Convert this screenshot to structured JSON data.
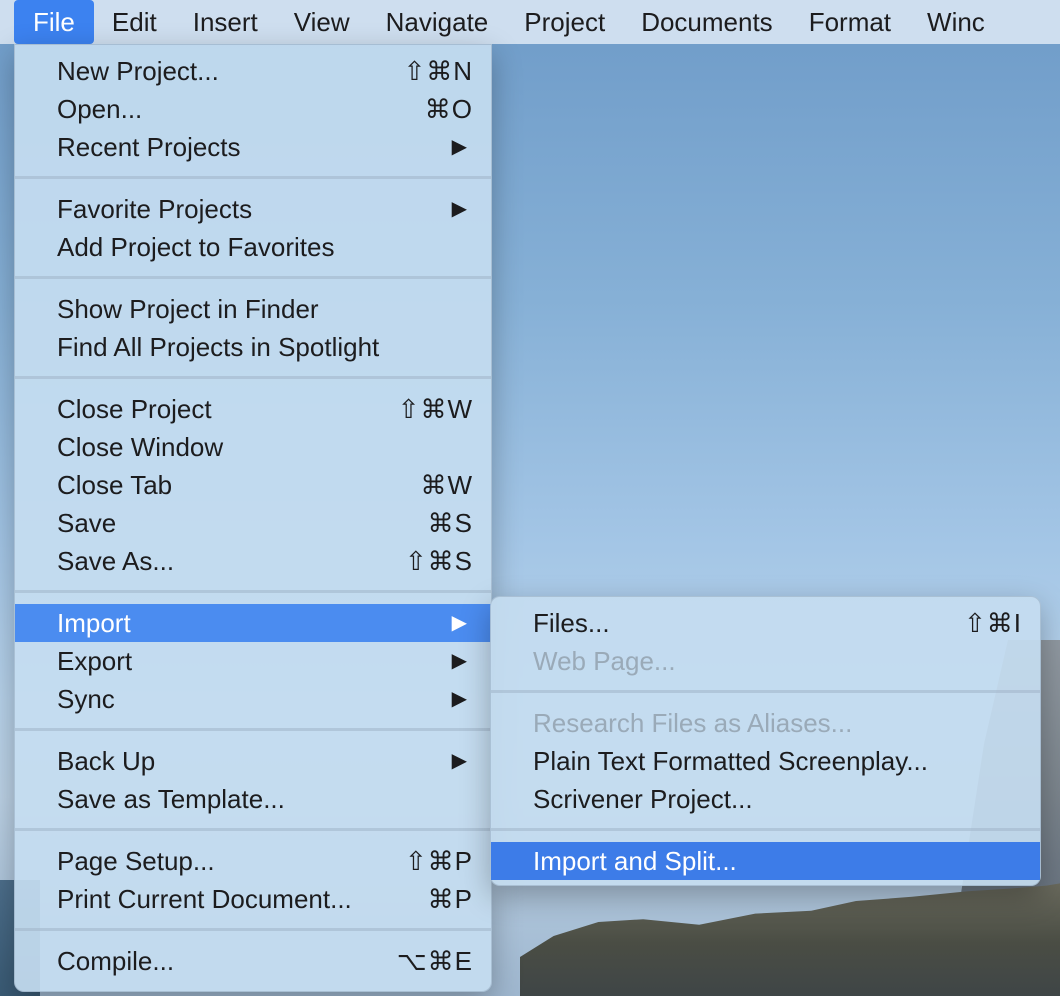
{
  "menubar": {
    "items": [
      "File",
      "Edit",
      "Insert",
      "View",
      "Navigate",
      "Project",
      "Documents",
      "Format",
      "Winc"
    ]
  },
  "file_menu": {
    "new_project": {
      "label": "New Project...",
      "shortcut": "⇧⌘N"
    },
    "open": {
      "label": "Open...",
      "shortcut": "⌘O"
    },
    "recent_projects": {
      "label": "Recent Projects"
    },
    "favorite_projects": {
      "label": "Favorite Projects"
    },
    "add_project_to_favorites": {
      "label": "Add Project to Favorites"
    },
    "show_project_in_finder": {
      "label": "Show Project in Finder"
    },
    "find_all_projects": {
      "label": "Find All Projects in Spotlight"
    },
    "close_project": {
      "label": "Close Project",
      "shortcut": "⇧⌘W"
    },
    "close_window": {
      "label": "Close Window"
    },
    "close_tab": {
      "label": "Close Tab",
      "shortcut": "⌘W"
    },
    "save": {
      "label": "Save",
      "shortcut": "⌘S"
    },
    "save_as": {
      "label": "Save As...",
      "shortcut": "⇧⌘S"
    },
    "import": {
      "label": "Import"
    },
    "export": {
      "label": "Export"
    },
    "sync": {
      "label": "Sync"
    },
    "back_up": {
      "label": "Back Up"
    },
    "save_as_template": {
      "label": "Save as Template..."
    },
    "page_setup": {
      "label": "Page Setup...",
      "shortcut": "⇧⌘P"
    },
    "print_current_document": {
      "label": "Print Current Document...",
      "shortcut": "⌘P"
    },
    "compile": {
      "label": "Compile...",
      "shortcut": "⌥⌘E"
    }
  },
  "import_menu": {
    "files": {
      "label": "Files...",
      "shortcut": "⇧⌘I"
    },
    "web_page": {
      "label": "Web Page..."
    },
    "research_files_as_aliases": {
      "label": "Research Files as Aliases..."
    },
    "plain_text_screenplay": {
      "label": "Plain Text Formatted Screenplay..."
    },
    "scrivener_project": {
      "label": "Scrivener Project..."
    },
    "import_and_split": {
      "label": "Import and Split..."
    }
  },
  "icons": {
    "submenu_arrow": "▶"
  },
  "colors": {
    "highlight": "#4b8cf0",
    "menubar_active": "#3c82f0"
  }
}
